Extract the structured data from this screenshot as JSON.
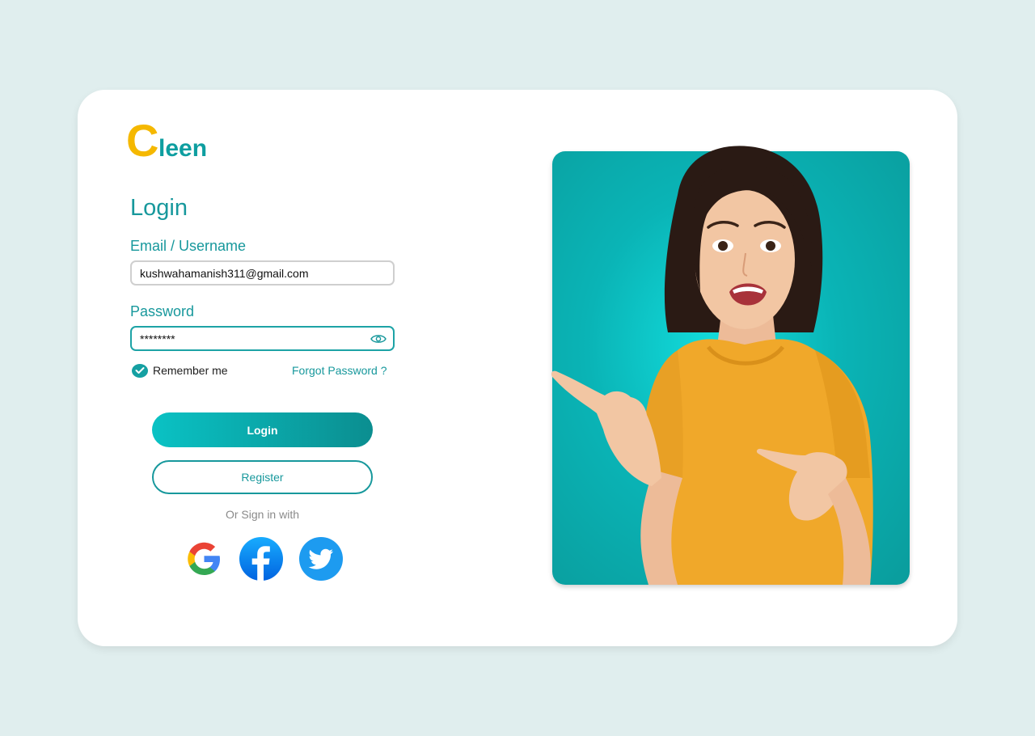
{
  "logo": {
    "letter": "C",
    "rest": "leen"
  },
  "login": {
    "title": "Login",
    "email_label": "Email / Username",
    "email_value": "kushwahamanish311@gmail.com",
    "password_label": "Password",
    "password_value": "********",
    "remember_label": "Remember me",
    "remember_checked": true,
    "forgot_label": "Forgot Password ?",
    "login_button": "Login",
    "register_button": "Register",
    "or_text": "Or Sign in with"
  },
  "social": [
    {
      "name": "google",
      "icon": "google-icon"
    },
    {
      "name": "facebook",
      "icon": "facebook-icon"
    },
    {
      "name": "twitter",
      "icon": "twitter-icon"
    }
  ],
  "colors": {
    "background": "#e0eeee",
    "accent": "#17989c",
    "logo_yellow": "#f5b800",
    "photo_bg": "#0ab4b6",
    "shirt": "#f0a82a"
  }
}
